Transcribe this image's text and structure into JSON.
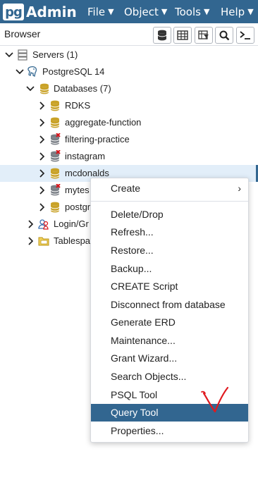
{
  "app": {
    "logo_pg": "pg",
    "logo_admin": "Admin",
    "menu": [
      {
        "label": "File"
      },
      {
        "label": "Object"
      },
      {
        "label": "Tools"
      },
      {
        "label": "Help"
      }
    ]
  },
  "browser": {
    "title": "Browser",
    "toolbar": [
      {
        "icon": "database-icon"
      },
      {
        "icon": "table-grid-icon"
      },
      {
        "icon": "filter-table-icon"
      },
      {
        "icon": "search-icon"
      },
      {
        "icon": "terminal-icon"
      }
    ]
  },
  "tree": [
    {
      "label": "Servers (1)",
      "icon": "servers-icon",
      "expanded": true
    },
    {
      "label": "PostgreSQL 14",
      "icon": "postgresql-elephant-icon",
      "expanded": true
    },
    {
      "label": "Databases (7)",
      "icon": "databases-icon",
      "expanded": true
    },
    {
      "label": "RDKS",
      "icon": "database-icon",
      "connected": true
    },
    {
      "label": "aggregate-function",
      "icon": "database-icon",
      "connected": true
    },
    {
      "label": "filtering-practice",
      "icon": "database-disconnected-icon",
      "connected": false
    },
    {
      "label": "instagram",
      "icon": "database-disconnected-icon",
      "connected": false
    },
    {
      "label": "mcdonalds",
      "icon": "database-icon",
      "connected": true,
      "selected": true
    },
    {
      "label": "mytes",
      "icon": "database-disconnected-icon",
      "connected": false
    },
    {
      "label": "postgr",
      "icon": "database-icon",
      "connected": true
    },
    {
      "label": "Login/Gr",
      "icon": "login-roles-icon"
    },
    {
      "label": "Tablespa",
      "icon": "tablespaces-icon"
    }
  ],
  "context_menu": {
    "items": [
      {
        "label": "Create",
        "submenu": true
      },
      {
        "label": "Delete/Drop"
      },
      {
        "label": "Refresh..."
      },
      {
        "label": "Restore..."
      },
      {
        "label": "Backup..."
      },
      {
        "label": "CREATE Script"
      },
      {
        "label": "Disconnect from database"
      },
      {
        "label": "Generate ERD"
      },
      {
        "label": "Maintenance..."
      },
      {
        "label": "Grant Wizard..."
      },
      {
        "label": "Search Objects..."
      },
      {
        "label": "PSQL Tool"
      },
      {
        "label": "Query Tool",
        "active": true
      },
      {
        "label": "Properties..."
      }
    ]
  },
  "colors": {
    "brand": "#326690",
    "selected_row": "#e2eef9",
    "annotation": "#e0191e",
    "db_gold": "#c9a227"
  },
  "annotation": {
    "icon": "hand-drawn-checkmark-icon"
  }
}
